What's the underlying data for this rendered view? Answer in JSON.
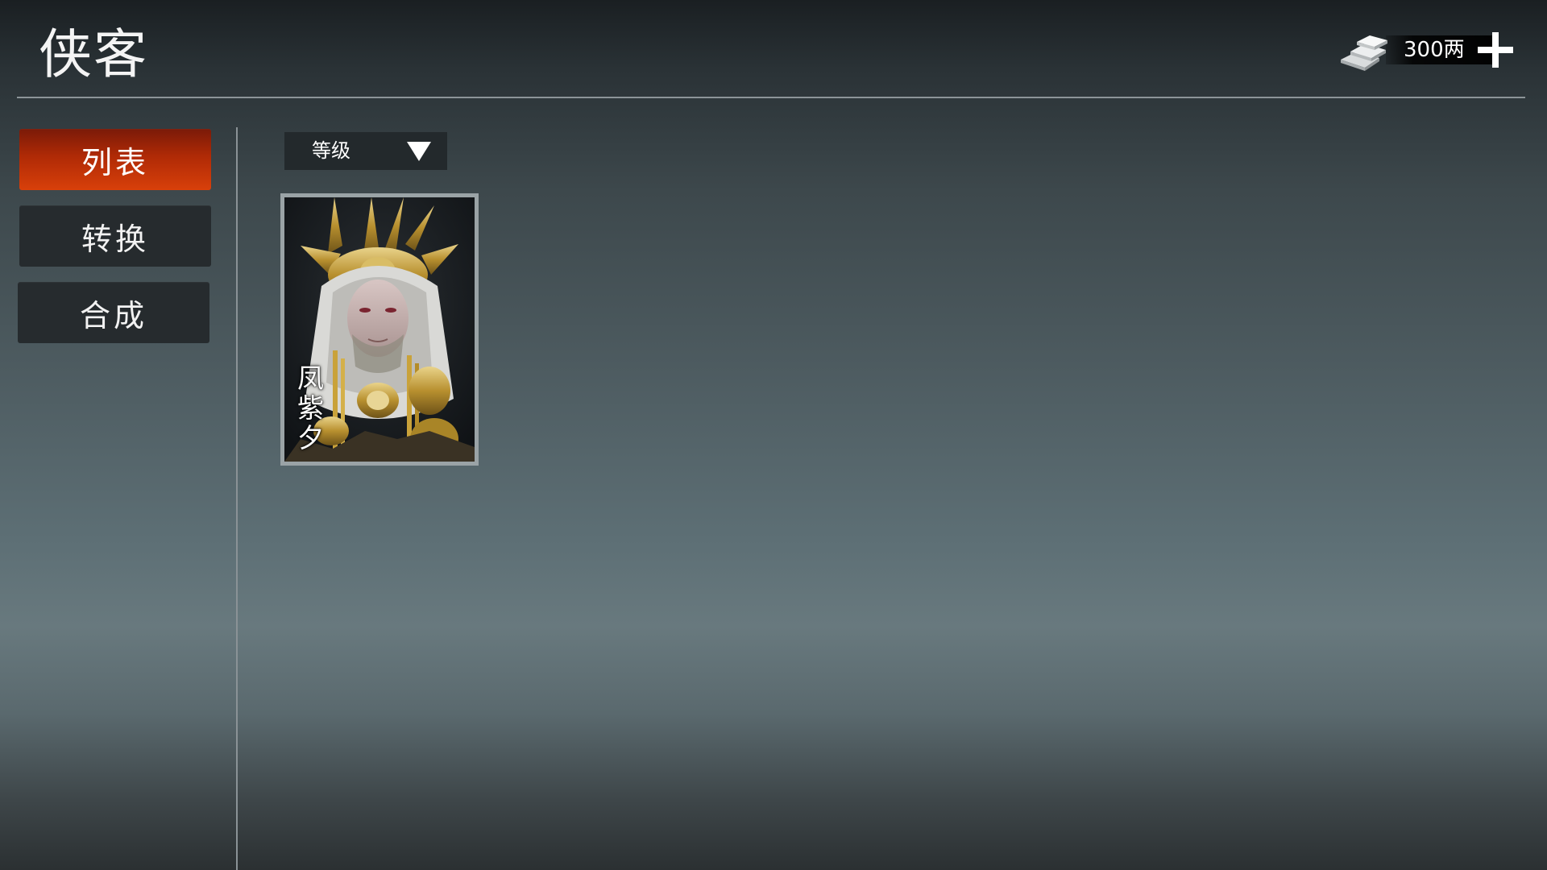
{
  "header": {
    "title": "侠客"
  },
  "currency": {
    "value": "300两",
    "icon": "silver-ingot-icon",
    "add_icon": "plus-icon"
  },
  "sidebar": {
    "tabs": [
      {
        "label": "列表",
        "active": true
      },
      {
        "label": "转换",
        "active": false
      },
      {
        "label": "合成",
        "active": false
      }
    ]
  },
  "sort": {
    "selected": "等级",
    "icon": "triangle-down-icon"
  },
  "characters": [
    {
      "name": "凤紫夕"
    }
  ],
  "colors": {
    "active_tab": "#c8360a",
    "inactive_tab": "#262b2e",
    "dropdown_bg": "#23292c",
    "card_border": "#9aa3a6"
  }
}
